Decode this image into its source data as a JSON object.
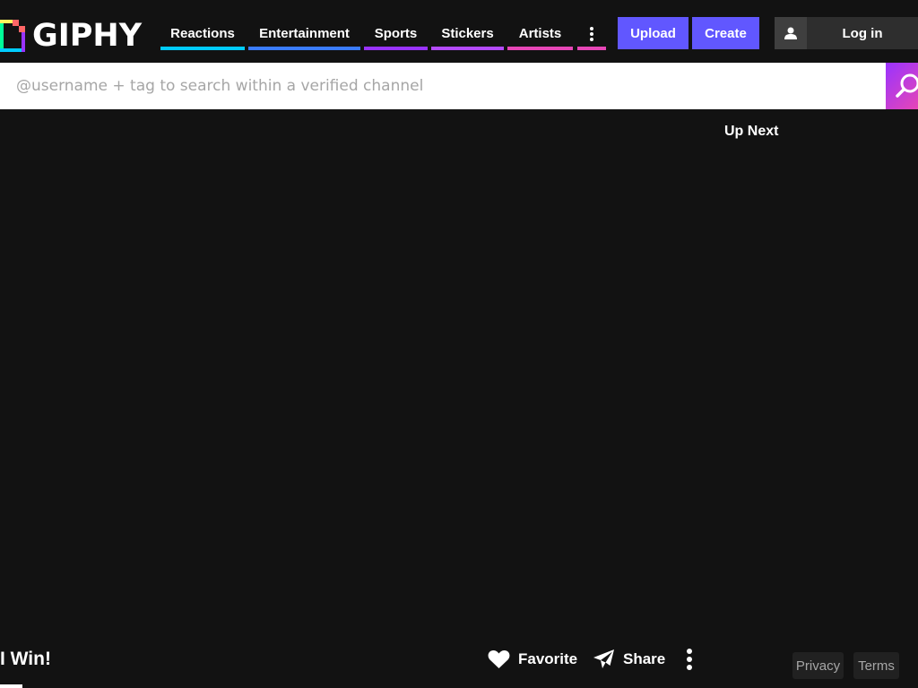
{
  "header": {
    "logo_text": "GIPHY",
    "nav": [
      {
        "label": "Reactions",
        "color": "#00ccff"
      },
      {
        "label": "Entertainment",
        "color": "#3a7cff"
      },
      {
        "label": "Sports",
        "color": "#9933ff"
      },
      {
        "label": "Stickers",
        "color": "#b44bff"
      },
      {
        "label": "Artists",
        "color": "#e646b6"
      }
    ],
    "more_color": "#ff6666",
    "upload_label": "Upload",
    "create_label": "Create",
    "login_label": "Log in",
    "accent": "#6157ff"
  },
  "search": {
    "placeholder": "@username + tag to search within a verified channel"
  },
  "sidebar": {
    "up_next_label": "Up Next"
  },
  "gif": {
    "title": "I Win!",
    "favorite_label": "Favorite",
    "share_label": "Share"
  },
  "footer": {
    "privacy_label": "Privacy",
    "terms_label": "Terms"
  }
}
